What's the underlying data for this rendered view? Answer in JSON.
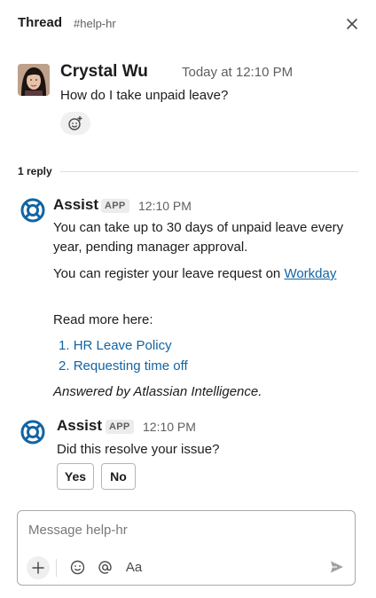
{
  "header": {
    "title": "Thread",
    "channel": "#help-hr",
    "close_icon": "close-icon"
  },
  "parent_message": {
    "author": "Crystal Wu",
    "timestamp": "Today at 12:10 PM",
    "text": "How do I take unpaid leave?",
    "reaction_icon": "add-reaction-icon"
  },
  "replies": {
    "count_label": "1 reply"
  },
  "bot_message_1": {
    "author": "Assist",
    "badge": "APP",
    "timestamp": "12:10 PM",
    "paragraph_1": "You can take up to 30 days of unpaid leave every year, pending manager approval.",
    "paragraph_2_prefix": "You can register your leave request on ",
    "paragraph_2_link": "Workday",
    "read_more": "Read more here:",
    "links": [
      {
        "number": "1.",
        "label": "HR Leave Policy"
      },
      {
        "number": "2.",
        "label": "Requesting time off"
      }
    ],
    "footer": "Answered by Atlassian Intelligence."
  },
  "bot_message_2": {
    "author": "Assist",
    "badge": "APP",
    "timestamp": "12:10 PM",
    "text": "Did this resolve your issue?",
    "yes_label": "Yes",
    "no_label": "No"
  },
  "composer": {
    "placeholder": "Message help-hr",
    "format_label": "Aa"
  },
  "colors": {
    "link": "#1264a3",
    "bot_icon": "#1264a3",
    "text": "#1d1c1d",
    "muted": "#616061"
  }
}
